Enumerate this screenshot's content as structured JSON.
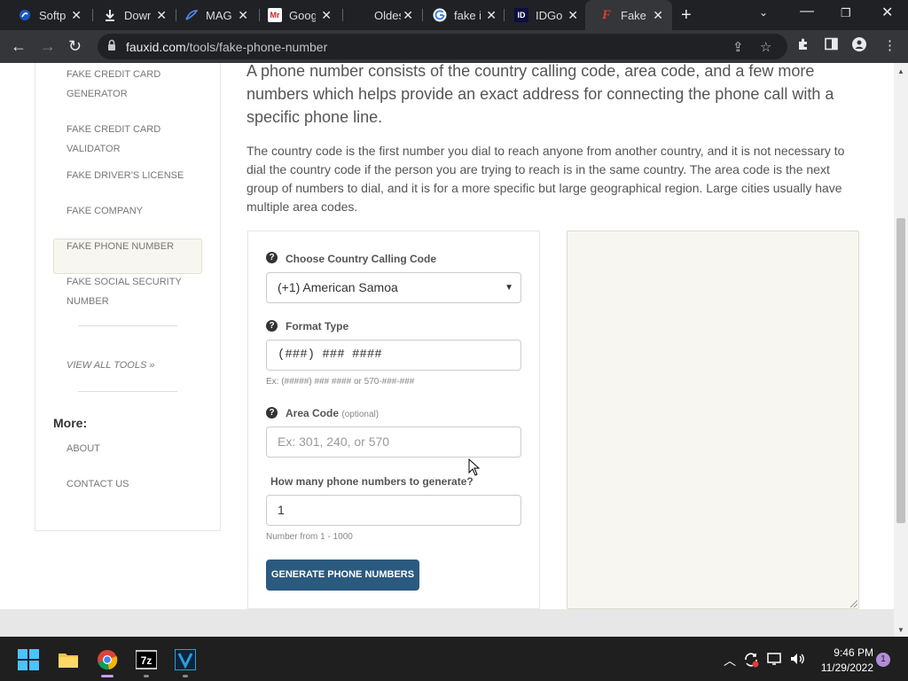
{
  "browser": {
    "tabs": [
      {
        "title": "Softp",
        "favicon": "softpedia-icon",
        "active": false
      },
      {
        "title": "Down",
        "favicon": "download-icon",
        "active": false
      },
      {
        "title": "MAGI",
        "favicon": "feather-icon",
        "active": false
      },
      {
        "title": "Goog",
        "favicon": "mr-icon",
        "active": false
      },
      {
        "title": "Oldes",
        "favicon": "blank-icon",
        "active": false
      },
      {
        "title": "fake i",
        "favicon": "google-icon",
        "active": false
      },
      {
        "title": "IDGo",
        "favicon": "id-icon",
        "active": false
      },
      {
        "title": "Fake I",
        "favicon": "fauxid-icon",
        "active": true
      }
    ],
    "url_domain": "fauxid.com",
    "url_path": "/tools/fake-phone-number"
  },
  "sidebar": {
    "links": [
      {
        "label": "FAKE CREDIT CARD GENERATOR"
      },
      {
        "label": "FAKE CREDIT CARD VALIDATOR"
      },
      {
        "label": "FAKE DRIVER'S LICENSE"
      },
      {
        "label": "FAKE COMPANY"
      },
      {
        "label": "FAKE PHONE NUMBER"
      },
      {
        "label": "FAKE SOCIAL SECURITY NUMBER"
      }
    ],
    "view_all": "VIEW ALL TOOLS »",
    "more_heading": "More:",
    "more_links": [
      {
        "label": "ABOUT"
      },
      {
        "label": "CONTACT US"
      }
    ]
  },
  "content": {
    "intro": "A phone number consists of the country calling code, area code, and a few more numbers which helps provide an exact address for connecting the phone call with a specific phone line.",
    "paragraph": "The country code is the first number you dial to reach anyone from another country, and it is not necessary to dial the country code if the person you are trying to reach is in the same country. The area code is the next group of numbers to dial, and it is for a more specific but large geographical region. Large cities usually have multiple area codes."
  },
  "form": {
    "country_label": "Choose Country Calling Code",
    "country_value": "(+1) American Samoa",
    "format_label": "Format Type",
    "format_value": "(###) ### ####",
    "format_help": "Ex: (#####) ### #### or 570-###-###",
    "area_label": "Area Code",
    "area_optional": "(optional)",
    "area_placeholder": "Ex: 301, 240, or 570",
    "count_label": "How many phone numbers to generate?",
    "count_value": "1",
    "count_help": "Number from 1 - 1000",
    "generate_label": "GENERATE PHONE NUMBERS"
  },
  "taskbar": {
    "time": "9:46 PM",
    "date": "11/29/2022",
    "notifications": "1"
  }
}
